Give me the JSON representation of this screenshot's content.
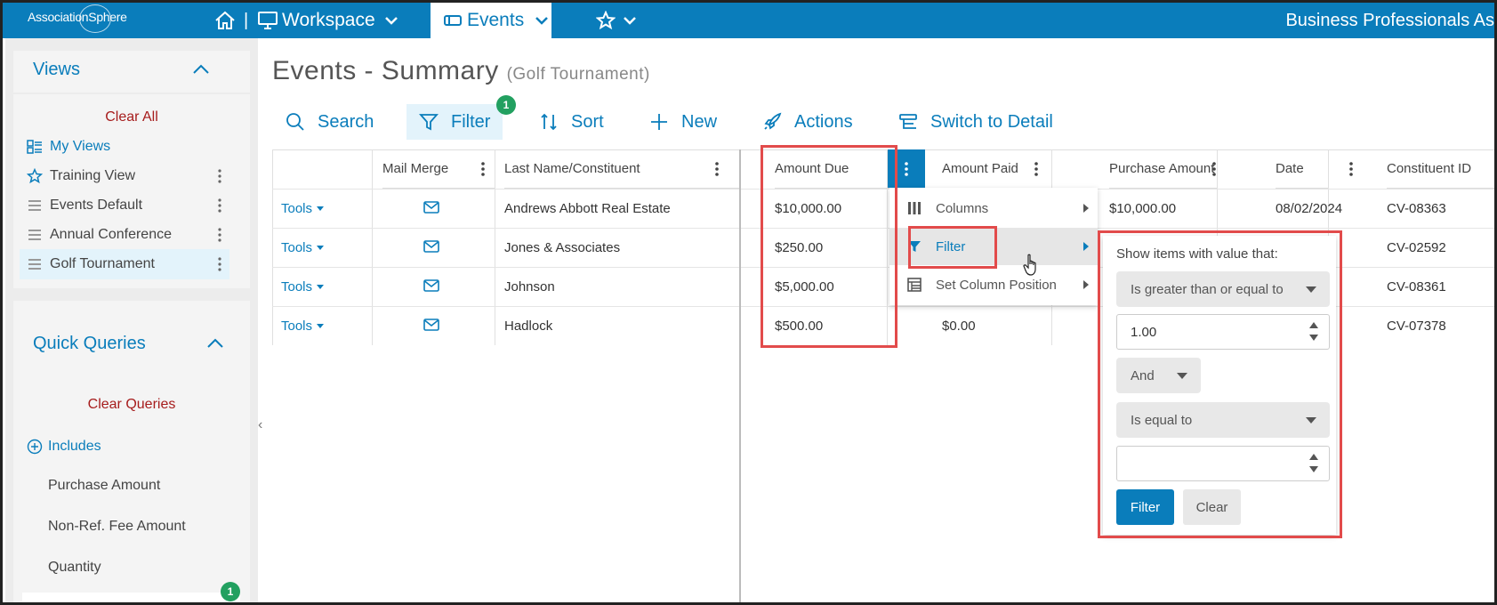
{
  "topbar": {
    "logo": "AssociationSphere",
    "separator": "|",
    "workspace": "Workspace",
    "events": "Events",
    "org": "Business Professionals As"
  },
  "sidebar": {
    "views_title": "Views",
    "clear_all": "Clear All",
    "views": [
      {
        "label": "My Views"
      },
      {
        "label": "Training View"
      },
      {
        "label": "Events Default"
      },
      {
        "label": "Annual Conference"
      },
      {
        "label": "Golf Tournament"
      }
    ],
    "quick_title": "Quick Queries",
    "clear_queries": "Clear Queries",
    "includes": "Includes",
    "queries": [
      "Purchase Amount",
      "Non-Ref. Fee Amount",
      "Quantity"
    ],
    "badge": "1"
  },
  "page": {
    "title": "Events - Summary",
    "subtitle": "(Golf Tournament)"
  },
  "toolbar": {
    "search": "Search",
    "filter": "Filter",
    "filter_badge": "1",
    "sort": "Sort",
    "new": "New",
    "actions": "Actions",
    "switch": "Switch to Detail"
  },
  "grid": {
    "headers": {
      "mail_merge": "Mail Merge",
      "last_name": "Last Name/Constituent",
      "amount_due": "Amount Due",
      "amount_paid": "Amount Paid",
      "purchase_amount": "Purchase Amount",
      "date": "Date",
      "constituent_id": "Constituent ID"
    },
    "tools_label": "Tools",
    "rows": [
      {
        "name": "Andrews Abbott Real Estate",
        "due": "$10,000.00",
        "paid": "",
        "purchase": "$10,000.00",
        "date": "08/02/2024",
        "cid": "CV-08363"
      },
      {
        "name": "Jones & Associates",
        "due": "$250.00",
        "paid": "",
        "purchase": "",
        "date": "",
        "cid": "CV-02592"
      },
      {
        "name": "Johnson",
        "due": "$5,000.00",
        "paid": "",
        "purchase": "",
        "date": "",
        "cid": "CV-08361"
      },
      {
        "name": "Hadlock",
        "due": "$500.00",
        "paid": "$0.00",
        "purchase": "",
        "date": "",
        "cid": "CV-07378"
      }
    ]
  },
  "column_menu": {
    "columns": "Columns",
    "filter": "Filter",
    "set_position": "Set Column Position"
  },
  "filter_panel": {
    "label": "Show items with value that:",
    "operator1": "Is greater than or equal to",
    "value1": "1.00",
    "logic": "And",
    "operator2": "Is equal to",
    "value2": "",
    "filter_btn": "Filter",
    "clear_btn": "Clear"
  },
  "colors": {
    "brand": "#0a7dbb",
    "highlight": "#e24b4b",
    "badge": "#22a060",
    "clear_link": "#a61c1c"
  }
}
